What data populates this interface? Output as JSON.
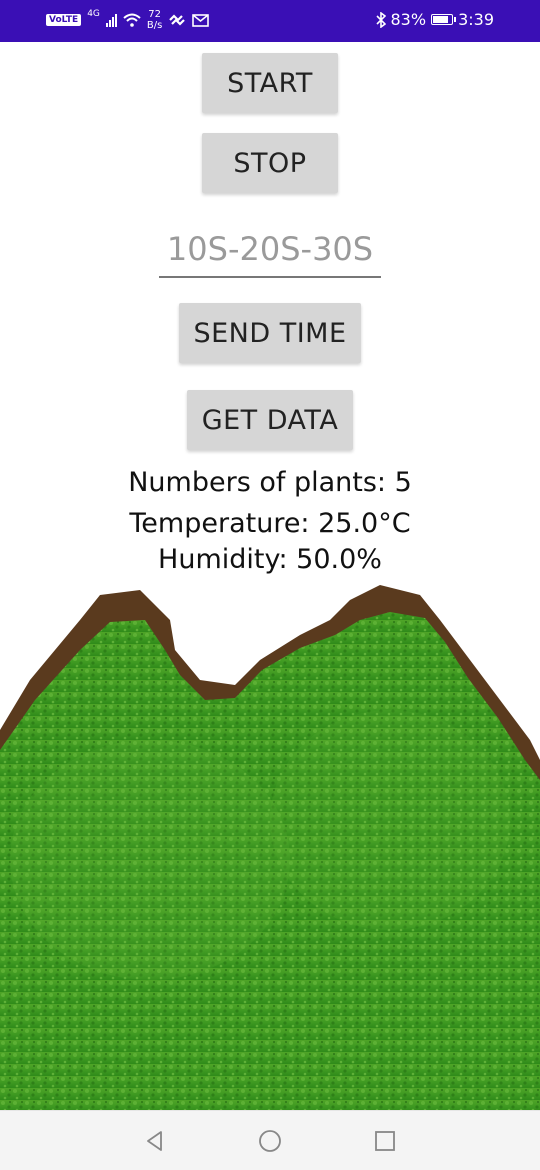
{
  "status_bar": {
    "volte": "VoLTE",
    "network": "4G",
    "speed_value": "72",
    "speed_unit": "B/s",
    "battery": "83%",
    "battery_level": 0.83,
    "time": "3:39",
    "background_color": "#3a0fb5"
  },
  "controls": {
    "start_label": "START",
    "stop_label": "STOP",
    "time_placeholder": "10S-20S-30S",
    "send_time_label": "SEND TIME",
    "get_data_label": "GET DATA"
  },
  "readings": {
    "plants": "Numbers of plants: 5",
    "temperature": "Temperature: 25.0°C",
    "humidity": "Humidity: 50.0%"
  },
  "nav": {
    "back": "back-icon",
    "home": "home-icon",
    "recents": "recents-icon"
  }
}
